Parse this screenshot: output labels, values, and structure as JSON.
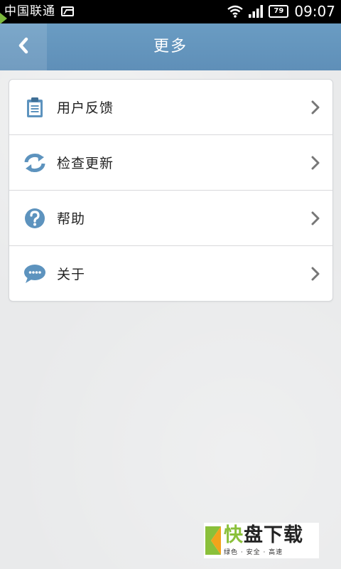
{
  "status_bar": {
    "carrier": "中国联通",
    "battery": "79",
    "time": "09:07",
    "icons": [
      "image-notification-icon",
      "wifi-icon",
      "signal-icon",
      "battery-icon"
    ]
  },
  "header": {
    "title": "更多",
    "back_icon": "chevron-left-icon"
  },
  "menu": {
    "items": [
      {
        "label": "用户反馈",
        "icon": "clipboard-icon"
      },
      {
        "label": "检查更新",
        "icon": "refresh-icon"
      },
      {
        "label": "帮助",
        "icon": "help-icon"
      },
      {
        "label": "关于",
        "icon": "chat-bubble-icon"
      }
    ]
  },
  "watermark": {
    "brand_k": "快",
    "brand_rest": "盘下载",
    "tagline": "绿色 · 安全 · 高速"
  },
  "colors": {
    "header": "#6395be",
    "icon": "#5d93be",
    "brand_green": "#8ac03a"
  }
}
